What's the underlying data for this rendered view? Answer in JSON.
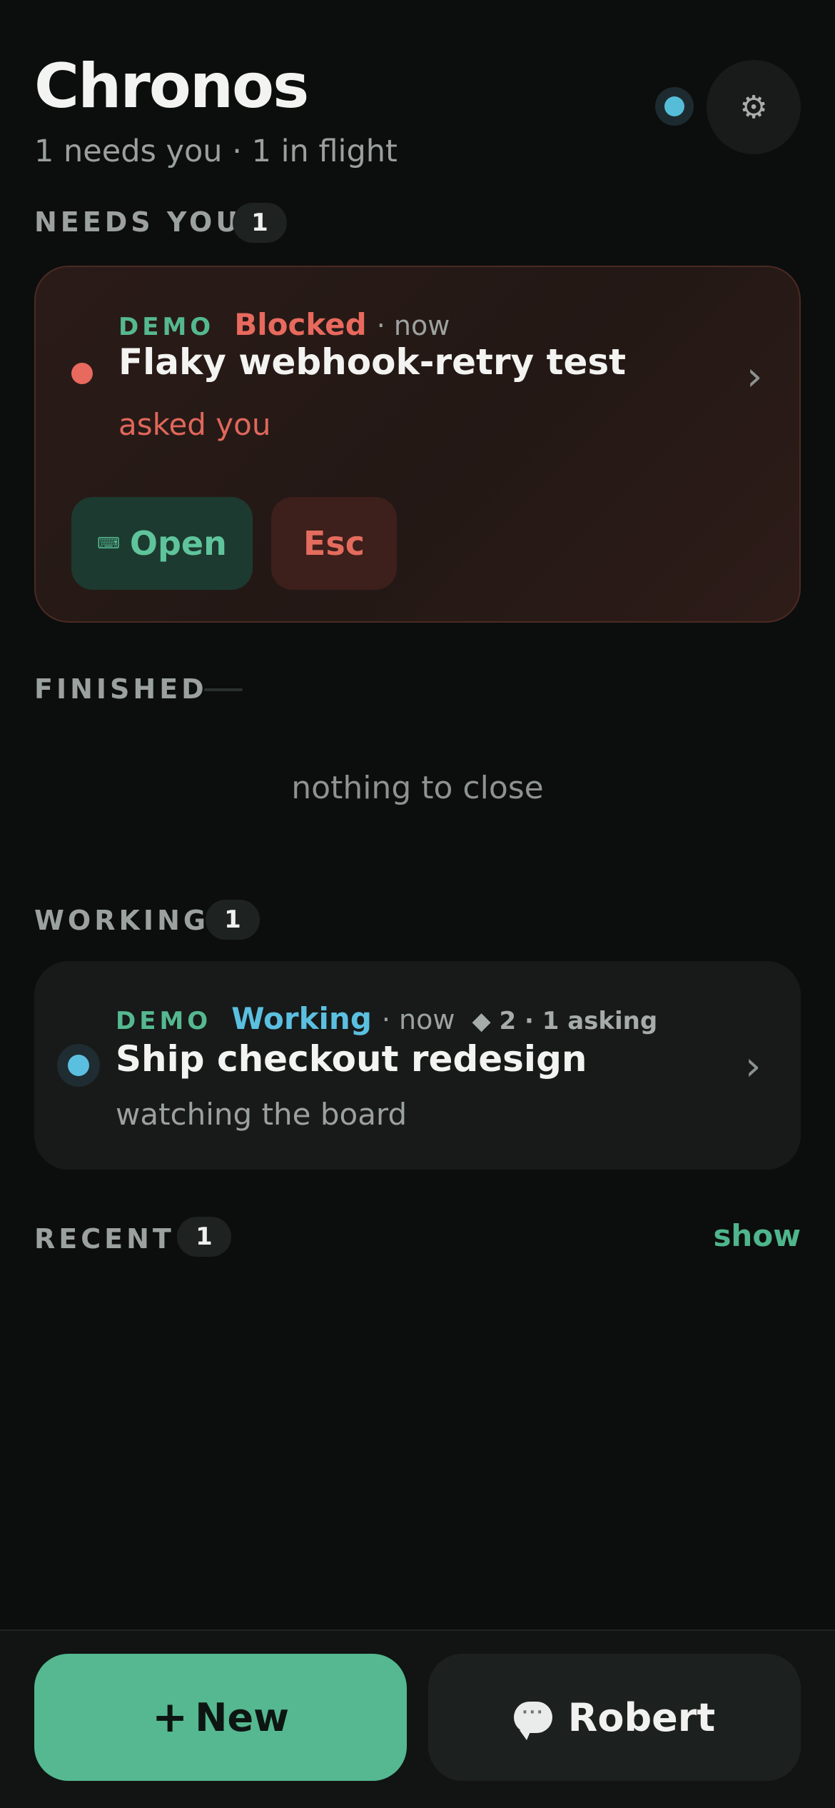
{
  "header": {
    "title": "Chronos",
    "subtitle": "1 needs you · 1 in flight",
    "settings_icon": "⚙"
  },
  "colors": {
    "accent": "#55b890",
    "blocked": "#e8695d",
    "working": "#5bbfe0",
    "background": "#0c0e0d"
  },
  "sections": {
    "needs_you": {
      "label": "NEEDS YOU",
      "count": "1",
      "card": {
        "tag": "DEMO",
        "state": "Blocked",
        "time": "· now",
        "title": "Flaky webhook-retry test",
        "subtitle": "asked you",
        "chevron": "›",
        "open_label": "Open",
        "open_icon": "⌨",
        "esc_label": "Esc"
      }
    },
    "finished": {
      "label": "FINISHED",
      "empty_text": "nothing to close"
    },
    "working": {
      "label": "WORKING",
      "count": "1",
      "card": {
        "tag": "DEMO",
        "state": "Working",
        "time": "· now",
        "meta": "◆ 2 · 1 asking",
        "title": "Ship checkout redesign",
        "subtitle": "watching the board",
        "chevron": "›"
      }
    },
    "recent": {
      "label": "RECENT",
      "count": "1",
      "show_label": "show"
    }
  },
  "bottom": {
    "new_plus": "+",
    "new_label": "New",
    "chat_dots": "···",
    "user_label": "Robert"
  }
}
